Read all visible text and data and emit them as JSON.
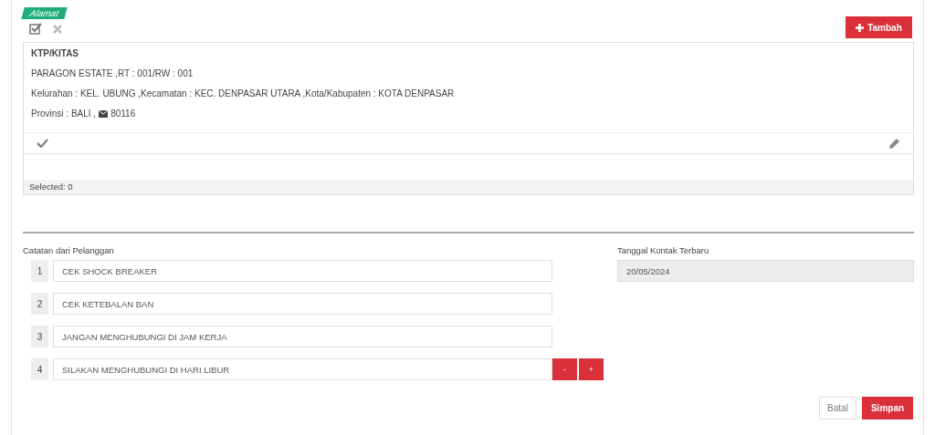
{
  "address": {
    "tag": "Alamat",
    "add_button": "Tambah",
    "card": {
      "title": "KTP/KITAS",
      "street": "PARAGON ESTATE ,RT : 001/RW : 001",
      "region": "Kelurahan : KEL. UBUNG ,Kecamatan : KEC. DENPASAR UTARA ,Kota/Kabupaten : KOTA DENPASAR",
      "province": "Provinsi : BALI ,",
      "postal_code": "80116"
    },
    "selected_text": "Selected: 0"
  },
  "notes": {
    "label": "Catatan dari Pelanggan",
    "rows": [
      {
        "number": "1",
        "value": "CEK SHOCK BREAKER"
      },
      {
        "number": "2",
        "value": "CEK KETEBALAN BAN"
      },
      {
        "number": "3",
        "value": "JANGAN MENGHUBUNGI DI JAM KERJA"
      },
      {
        "number": "4",
        "value": "SILAKAN MENGHUBUNGI DI HARI LIBUR"
      }
    ],
    "remove_button": "-",
    "add_button": "+"
  },
  "last_contact": {
    "label": "Tanggal Kontak Terbaru",
    "value": "20/05/2024",
    "disabled": true
  },
  "buttons": {
    "cancel": "Batal",
    "save": "Simpan"
  }
}
